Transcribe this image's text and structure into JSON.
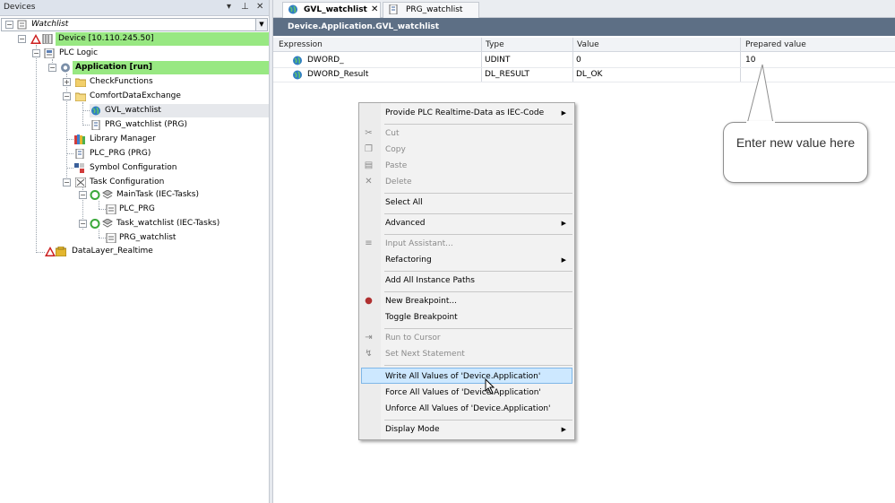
{
  "devices": {
    "title": "Devices",
    "pin_glyph": "▾ ⊥",
    "close_glyph": "✕",
    "combo_value": "Watchlist",
    "tree": [
      {
        "label": "Watchlist",
        "icon": "watchlist-root-icon"
      },
      {
        "label": "Device  [10.110.245.50]",
        "icon": "device-icon"
      },
      {
        "label": "PLC Logic",
        "icon": "plc-logic-icon"
      },
      {
        "label": "Application [run]",
        "icon": "application-gear-icon"
      },
      {
        "label": "CheckFunctions",
        "icon": "folder-icon"
      },
      {
        "label": "ComfortDataExchange",
        "icon": "folder-icon"
      },
      {
        "label": "GVL_watchlist",
        "icon": "globe-icon"
      },
      {
        "label": "PRG_watchlist (PRG)",
        "icon": "program-icon"
      },
      {
        "label": "Library Manager",
        "icon": "library-icon"
      },
      {
        "label": "PLC_PRG (PRG)",
        "icon": "program-icon"
      },
      {
        "label": "Symbol Configuration",
        "icon": "symbol-config-icon"
      },
      {
        "label": "Task Configuration",
        "icon": "task-config-icon"
      },
      {
        "label": "MainTask (IEC-Tasks)",
        "icon": "task-icon"
      },
      {
        "label": "PLC_PRG",
        "icon": "program-call-icon"
      },
      {
        "label": "Task_watchlist (IEC-Tasks)",
        "icon": "task-icon"
      },
      {
        "label": "PRG_watchlist",
        "icon": "program-call-icon"
      },
      {
        "label": "DataLayer_Realtime",
        "icon": "datalayer-icon"
      }
    ]
  },
  "tabs": [
    {
      "label": "GVL_watchlist",
      "close": "✕"
    },
    {
      "label": "PRG_watchlist"
    }
  ],
  "editor": {
    "header": "Device.Application.GVL_watchlist",
    "columns": [
      "Expression",
      "Type",
      "Value",
      "Prepared value"
    ],
    "rows": [
      {
        "expression": "DWORD_",
        "type": "UDINT",
        "value": "0",
        "prepared": "10"
      },
      {
        "expression": "DWORD_Result",
        "type": "DL_RESULT",
        "value": "DL_OK",
        "prepared": ""
      }
    ]
  },
  "context_menu": {
    "items": [
      {
        "label": "Provide PLC Realtime-Data as IEC-Code",
        "submenu": "▶"
      },
      {
        "label": "Cut",
        "icon": "cut-icon"
      },
      {
        "label": "Copy",
        "icon": "copy-icon"
      },
      {
        "label": "Paste",
        "icon": "paste-icon"
      },
      {
        "label": "Delete",
        "icon": "delete-icon"
      },
      {
        "label": "Select All"
      },
      {
        "label": "Advanced",
        "submenu": "▶"
      },
      {
        "label": "Input Assistant...",
        "icon": "input-assistant-icon"
      },
      {
        "label": "Refactoring",
        "submenu": "▶"
      },
      {
        "label": "Add All Instance Paths"
      },
      {
        "label": "New Breakpoint...",
        "icon": "breakpoint-icon"
      },
      {
        "label": "Toggle Breakpoint"
      },
      {
        "label": "Run to Cursor",
        "icon": "run-to-cursor-icon"
      },
      {
        "label": "Set Next Statement",
        "icon": "set-next-statement-icon"
      },
      {
        "label": "Write All Values of 'Device.Application'"
      },
      {
        "label": "Force All Values of 'Device.Application'"
      },
      {
        "label": "Unforce All Values of 'Device.Application'"
      },
      {
        "label": "Display Mode",
        "submenu": "▶"
      }
    ]
  },
  "callout": {
    "text": "Enter new value here"
  },
  "colors": {
    "accent_green": "#98e882",
    "header_bg": "#5d6f85",
    "menu_hover": "#cde8ff"
  }
}
